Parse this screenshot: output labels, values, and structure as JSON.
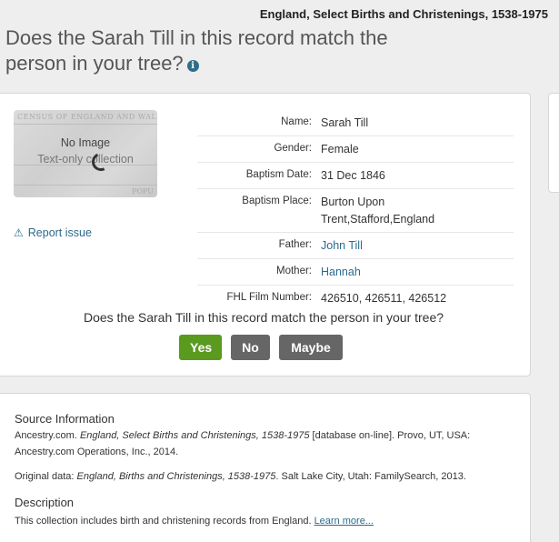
{
  "collection_title": "England, Select Births and Christenings, 1538-1975",
  "page_heading": "Does the Sarah Till in this record match the person in your tree?",
  "thumbnail": {
    "census_text": "CENSUS OF ENGLAND AND WALES,",
    "popu_text": "POPU",
    "no_image": "No Image",
    "text_only": "Text-only collection"
  },
  "report_issue": "Report issue",
  "fields": [
    {
      "label": "Name:",
      "value": "Sarah Till"
    },
    {
      "label": "Gender:",
      "value": "Female"
    },
    {
      "label": "Baptism Date:",
      "value": "31 Dec 1846"
    },
    {
      "label": "Baptism Place:",
      "value": "Burton Upon Trent,Stafford,England"
    },
    {
      "label": "Father:",
      "value": "John Till"
    },
    {
      "label": "Mother:",
      "value": "Hannah"
    },
    {
      "label": "FHL Film Number:",
      "value": "426510, 426511, 426512"
    }
  ],
  "match_question": "Does the Sarah Till in this record match the person in your tree?",
  "buttons": {
    "yes": "Yes",
    "no": "No",
    "maybe": "Maybe"
  },
  "source": {
    "heading": "Source Information",
    "citation_prefix": "Ancestry.com. ",
    "citation_title": "England, Select Births and Christenings, 1538-1975",
    "citation_suffix": " [database on-line]. Provo, UT, USA: Ancestry.com Operations, Inc., 2014.",
    "original_prefix": "Original data: ",
    "original_title": "England, Births and Christenings, 1538-1975",
    "original_suffix": ". Salt Lake City, Utah: FamilySearch, 2013.",
    "description_heading": "Description",
    "description_text": "This collection includes birth and christening records from England. ",
    "learn_more": "Learn more..."
  },
  "colors": {
    "accent_link": "#2c6a8d",
    "yes_button": "#5a9a1e",
    "neutral_button": "#666666"
  },
  "icons": {
    "heading_info": "info-icon",
    "report": "warning-icon",
    "loading": "spinner-icon"
  }
}
